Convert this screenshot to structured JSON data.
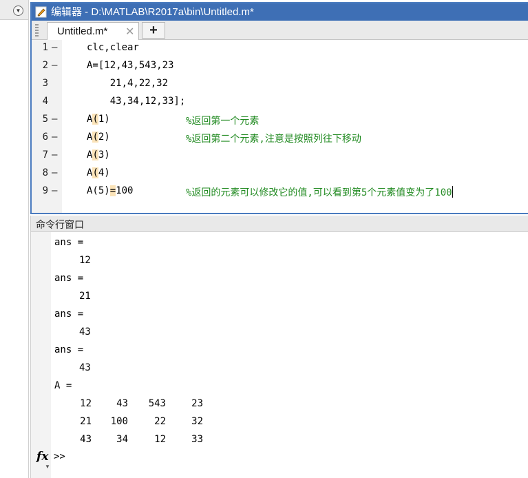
{
  "editor": {
    "title": "编辑器 - D:\\MATLAB\\R2017a\\bin\\Untitled.m*",
    "tab_label": "Untitled.m*",
    "tab_close": "✕",
    "tab_add": "+",
    "lines": [
      {
        "num": "1",
        "dash": "—",
        "code": "clc,clear",
        "comment": ""
      },
      {
        "num": "2",
        "dash": "—",
        "code": "A=[12,43,543,23",
        "comment": ""
      },
      {
        "num": "3",
        "dash": "",
        "code": "    21,4,22,32",
        "comment": ""
      },
      {
        "num": "4",
        "dash": "",
        "code": "    43,34,12,33];",
        "comment": ""
      },
      {
        "num": "5",
        "dash": "—",
        "code": "A(1)",
        "comment": "%返回第一个元素"
      },
      {
        "num": "6",
        "dash": "—",
        "code": "A(2)",
        "comment": "%返回第二个元素,注意是按照列往下移动"
      },
      {
        "num": "7",
        "dash": "—",
        "code": "A(3)",
        "comment": ""
      },
      {
        "num": "8",
        "dash": "—",
        "code": "A(4)",
        "comment": ""
      },
      {
        "num": "9",
        "dash": "—",
        "code": "A(5)=100",
        "comment": "%返回的元素可以修改它的值,可以看到第5个元素值变为了100"
      }
    ]
  },
  "command_window": {
    "title": "命令行窗口",
    "outputs": [
      {
        "label": "ans =",
        "value": "12"
      },
      {
        "label": "ans =",
        "value": "21"
      },
      {
        "label": "ans =",
        "value": "43"
      },
      {
        "label": "ans =",
        "value": "43"
      }
    ],
    "matrix_label": "A =",
    "matrix": [
      [
        "12",
        "43",
        "543",
        "23"
      ],
      [
        "21",
        "100",
        "22",
        "32"
      ],
      [
        "43",
        "34",
        "12",
        "33"
      ]
    ],
    "fx_label": "fx",
    "prompt": ">>"
  },
  "colors": {
    "title_bar": "#3e6fb5",
    "comment": "#228b22",
    "paren_highlight": "#fbe3b8"
  }
}
